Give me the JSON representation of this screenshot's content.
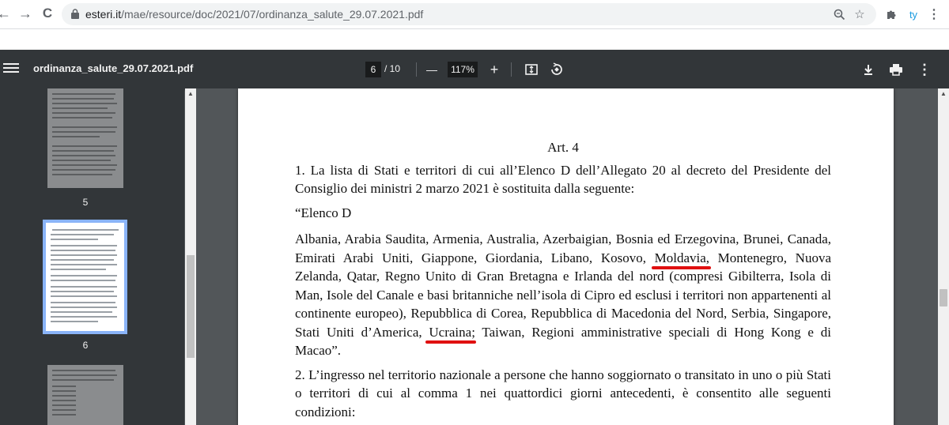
{
  "browser": {
    "url_host": "esteri.it",
    "url_path": "/mae/resource/doc/2021/07/ordinanza_salute_29.07.2021.pdf",
    "back_glyph": "←",
    "forward_glyph": "→",
    "reload_glyph": "C"
  },
  "toolbar": {
    "filename": "ordinanza_salute_29.07.2021.pdf",
    "current_page": "6",
    "total_pages": "/ 10",
    "zoom": "117%",
    "zoom_out_glyph": "—",
    "zoom_in_glyph": "+"
  },
  "sidebar": {
    "thumbnails": [
      {
        "label": "5"
      },
      {
        "label": "6"
      }
    ]
  },
  "document": {
    "article_title": "Art. 4",
    "para1": "1. La lista di Stati e territori di cui all’Elenco D dell’Allegato 20 al decreto del Presidente del Consiglio dei ministri 2 marzo 2021 è sostituita dalla seguente:",
    "elenco_title": "“Elenco D",
    "list_part1": "Albania, Arabia Saudita, Armenia, Australia, Azerbaigian, Bosnia ed Erzegovina, Brunei, Canada, Emirati Arabi Uniti,  Giappone, Giordania, Libano, Kosovo, ",
    "moldavia": "Moldavia",
    "list_part2": ", Montenegro, Nuova Zelanda, Qatar, Regno Unito di Gran Bretagna e Irlanda del nord (compresi Gibilterra, Isola di Man, Isole del Canale e basi britanniche nell’isola di Cipro ed esclusi i territori non appartenenti al continente europeo), Repubblica di Corea, Repubblica di Macedonia del Nord, Serbia, Singapore, Stati Uniti d’America, ",
    "ucraina": "Ucraina",
    "list_part3": "; Taiwan, Regioni amministrative speciali di Hong Kong e di Macao”.",
    "para2": "2. L’ingresso nel territorio nazionale a persone che hanno soggiornato o transitato in uno o più Stati o territori di cui al comma 1 nei quattordici giorni antecedenti, è consentito alle seguenti condizioni:"
  },
  "colors": {
    "underline": "#e01010",
    "toolbar_bg": "#323639",
    "viewer_bg": "#525659",
    "thumb_selected": "#8ab4f8"
  }
}
